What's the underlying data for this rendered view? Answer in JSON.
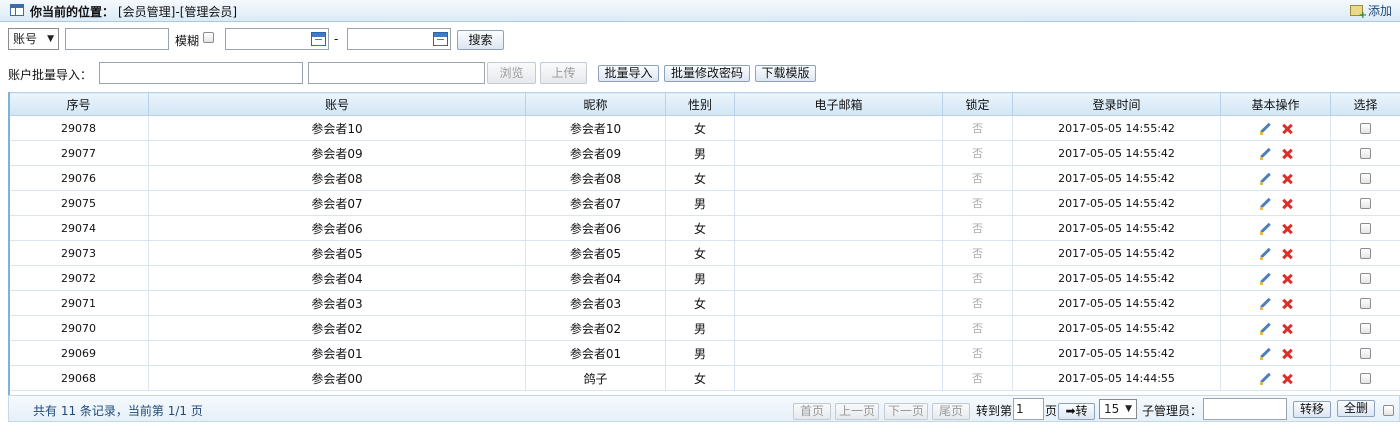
{
  "header": {
    "location_label": "你当前的位置：",
    "location_path": "[会员管理]-[管理会员]",
    "add_label": "添加"
  },
  "search": {
    "field_selected": "账号",
    "keyword_value": "",
    "fuzzy_label": "模糊",
    "date_from": "",
    "date_sep": "-",
    "date_to": "",
    "search_button": "搜索"
  },
  "import": {
    "label": "账户批量导入：",
    "browse_button": "浏览",
    "upload_button": "上传",
    "batch_import_button": "批量导入",
    "batch_password_button": "批量修改密码",
    "download_template_button": "下载模版"
  },
  "table": {
    "columns": [
      "序号",
      "账号",
      "昵称",
      "性别",
      "电子邮箱",
      "锁定",
      "登录时间",
      "基本操作",
      "选择"
    ],
    "rows": [
      {
        "id": "29078",
        "account": "参会者10",
        "nickname": "参会者10",
        "gender": "女",
        "email": "",
        "locked": "否",
        "login_time": "2017-05-05 14:55:42"
      },
      {
        "id": "29077",
        "account": "参会者09",
        "nickname": "参会者09",
        "gender": "男",
        "email": "",
        "locked": "否",
        "login_time": "2017-05-05 14:55:42"
      },
      {
        "id": "29076",
        "account": "参会者08",
        "nickname": "参会者08",
        "gender": "女",
        "email": "",
        "locked": "否",
        "login_time": "2017-05-05 14:55:42"
      },
      {
        "id": "29075",
        "account": "参会者07",
        "nickname": "参会者07",
        "gender": "男",
        "email": "",
        "locked": "否",
        "login_time": "2017-05-05 14:55:42"
      },
      {
        "id": "29074",
        "account": "参会者06",
        "nickname": "参会者06",
        "gender": "女",
        "email": "",
        "locked": "否",
        "login_time": "2017-05-05 14:55:42"
      },
      {
        "id": "29073",
        "account": "参会者05",
        "nickname": "参会者05",
        "gender": "女",
        "email": "",
        "locked": "否",
        "login_time": "2017-05-05 14:55:42"
      },
      {
        "id": "29072",
        "account": "参会者04",
        "nickname": "参会者04",
        "gender": "男",
        "email": "",
        "locked": "否",
        "login_time": "2017-05-05 14:55:42"
      },
      {
        "id": "29071",
        "account": "参会者03",
        "nickname": "参会者03",
        "gender": "女",
        "email": "",
        "locked": "否",
        "login_time": "2017-05-05 14:55:42"
      },
      {
        "id": "29070",
        "account": "参会者02",
        "nickname": "参会者02",
        "gender": "男",
        "email": "",
        "locked": "否",
        "login_time": "2017-05-05 14:55:42"
      },
      {
        "id": "29069",
        "account": "参会者01",
        "nickname": "参会者01",
        "gender": "男",
        "email": "",
        "locked": "否",
        "login_time": "2017-05-05 14:55:42"
      },
      {
        "id": "29068",
        "account": "参会者00",
        "nickname": "鸽子",
        "gender": "女",
        "email": "",
        "locked": "否",
        "login_time": "2017-05-05 14:44:55"
      }
    ]
  },
  "footer": {
    "summary": "共有 11 条记录，当前第 1/1 页",
    "first_page": "首页",
    "prev_page": "上一页",
    "next_page": "下一页",
    "last_page": "尾页",
    "goto_label": "转到第",
    "goto_value": "1",
    "page_unit": "页",
    "goto_button": "➡转",
    "page_size": "15",
    "sub_admin_label": "子管理员：",
    "sub_admin_value": "",
    "transfer_button": "转移",
    "select_all_button": "全删"
  },
  "colors": {
    "header_gradient_top": "#eaf4fc",
    "header_gradient_bottom": "#d2e6f5",
    "border": "#b7d1e8",
    "footer_text": "#1f4a7a",
    "delete_red": "#d9302c",
    "edit_blue": "#4f7fb8"
  },
  "icons": {
    "page": "window-icon",
    "add": "add-icon",
    "calendar": "calendar-icon",
    "edit": "pencil-icon",
    "delete": "delete-x-icon"
  }
}
